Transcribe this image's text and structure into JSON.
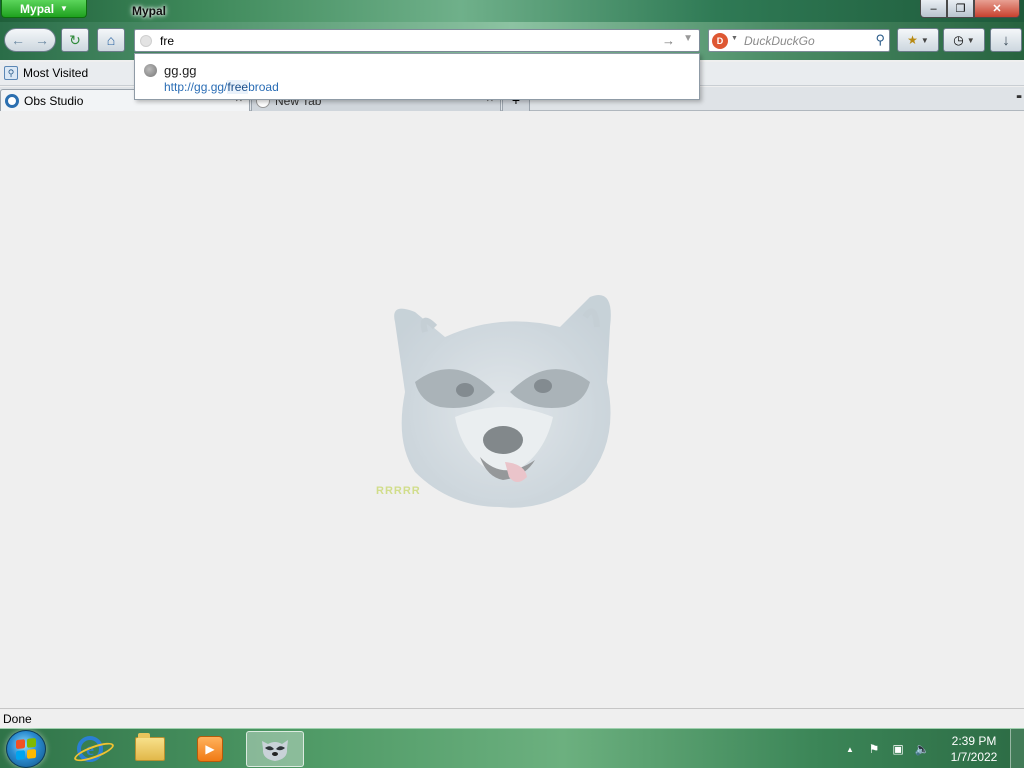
{
  "window": {
    "app_menu_label": "Mypal",
    "title": "Mypal",
    "controls": {
      "minimize": "–",
      "maximize": "❐",
      "close": "✕"
    }
  },
  "navbar": {
    "back_icon": "←",
    "forward_icon": "→",
    "reload_icon": "↻",
    "home_icon": "⌂",
    "url_value": "fre",
    "go_icon": "→",
    "url_dropdown_icon": "▼"
  },
  "search": {
    "engine_icon": "D",
    "placeholder": "DuckDuckGo",
    "go_icon": "⚲"
  },
  "toolbar": {
    "bookmarks_icon": "★",
    "history_icon": "◷",
    "download_icon": "↓",
    "caret": "▼"
  },
  "bookmarks_bar": {
    "items": [
      {
        "label": "Most Visited"
      }
    ]
  },
  "tabs": [
    {
      "label": "Obs Studio",
      "active": true
    },
    {
      "label": "New Tab",
      "active": false
    }
  ],
  "tab_close_icon": "✕",
  "new_tab_icon": "+",
  "tab_list_icon": "▪▪",
  "autocomplete": {
    "items": [
      {
        "title": "gg.gg",
        "url_prefix": "http://gg.gg/",
        "url_match": "free",
        "url_suffix": "broad"
      }
    ]
  },
  "content": {
    "watermark": "RRRRR"
  },
  "status": {
    "text": "Done"
  },
  "taskbar": {
    "media_icon": "▶",
    "tray": {
      "show_hidden": "▲",
      "flag": "⚑",
      "network": "▣",
      "volume": "🔈"
    },
    "clock": {
      "time": "2:39 PM",
      "date": "1/7/2022"
    }
  },
  "colors": {
    "accent_green": "#2f7348",
    "link_blue": "#2a6db5",
    "close_red": "#c7412e"
  }
}
